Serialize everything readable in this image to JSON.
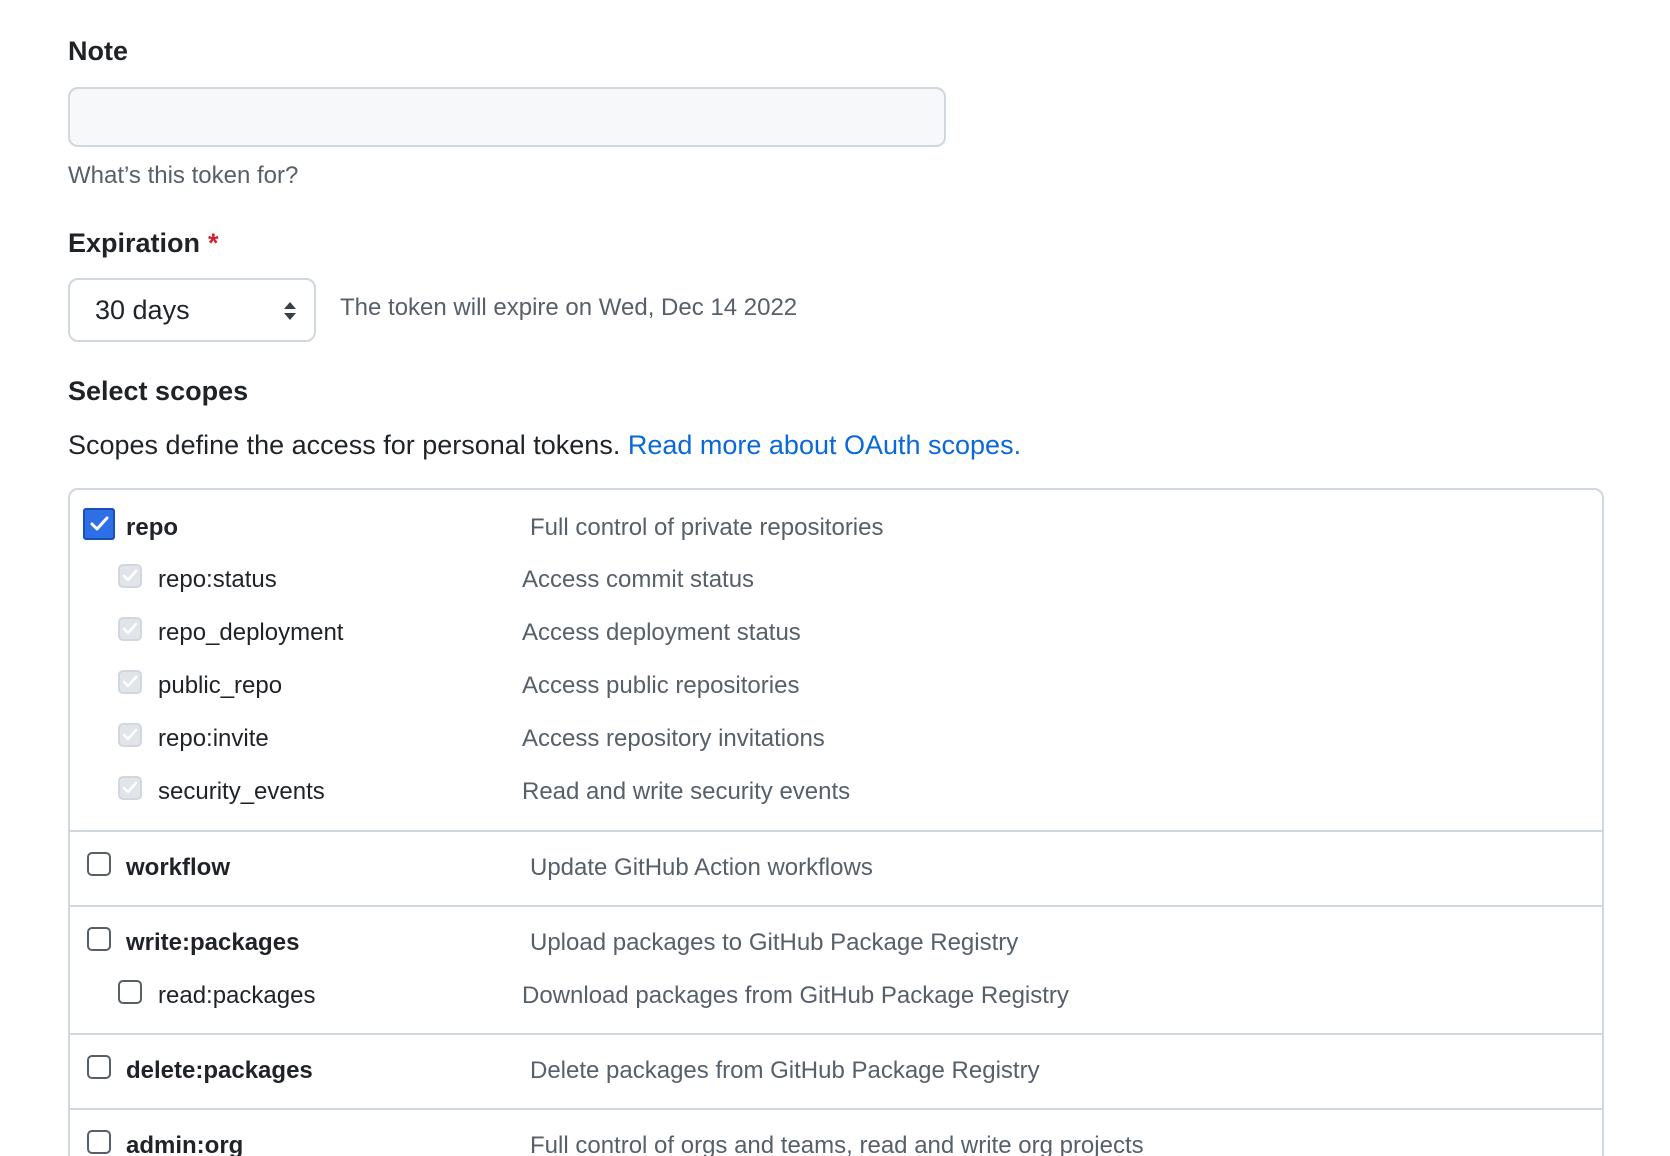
{
  "note": {
    "label": "Note",
    "value": "",
    "placeholder": "",
    "hint": "What’s this token for?"
  },
  "expiration": {
    "label": "Expiration",
    "required_mark": "*",
    "selected": "30 days",
    "info": "The token will expire on Wed, Dec 14 2022"
  },
  "scopes": {
    "title": "Select scopes",
    "description": "Scopes define the access for personal tokens.",
    "link_text": "Read more about OAuth scopes.",
    "groups": [
      {
        "parent": {
          "name": "repo",
          "desc": "Full control of private repositories",
          "checked": true
        },
        "children": [
          {
            "name": "repo:status",
            "desc": "Access commit status",
            "checked": true
          },
          {
            "name": "repo_deployment",
            "desc": "Access deployment status",
            "checked": true
          },
          {
            "name": "public_repo",
            "desc": "Access public repositories",
            "checked": true
          },
          {
            "name": "repo:invite",
            "desc": "Access repository invitations",
            "checked": true
          },
          {
            "name": "security_events",
            "desc": "Read and write security events",
            "checked": true
          }
        ]
      },
      {
        "parent": {
          "name": "workflow",
          "desc": "Update GitHub Action workflows",
          "checked": false
        },
        "children": []
      },
      {
        "parent": {
          "name": "write:packages",
          "desc": "Upload packages to GitHub Package Registry",
          "checked": false
        },
        "children": [
          {
            "name": "read:packages",
            "desc": "Download packages from GitHub Package Registry",
            "checked": false
          }
        ]
      },
      {
        "parent": {
          "name": "delete:packages",
          "desc": "Delete packages from GitHub Package Registry",
          "checked": false
        },
        "children": []
      },
      {
        "parent": {
          "name": "admin:org",
          "desc": "Full control of orgs and teams, read and write org projects",
          "checked": false
        },
        "children": []
      }
    ]
  },
  "colors": {
    "accent": "#0969da",
    "checkbox_checked": "#2f6fe6",
    "required": "#cf222e"
  }
}
